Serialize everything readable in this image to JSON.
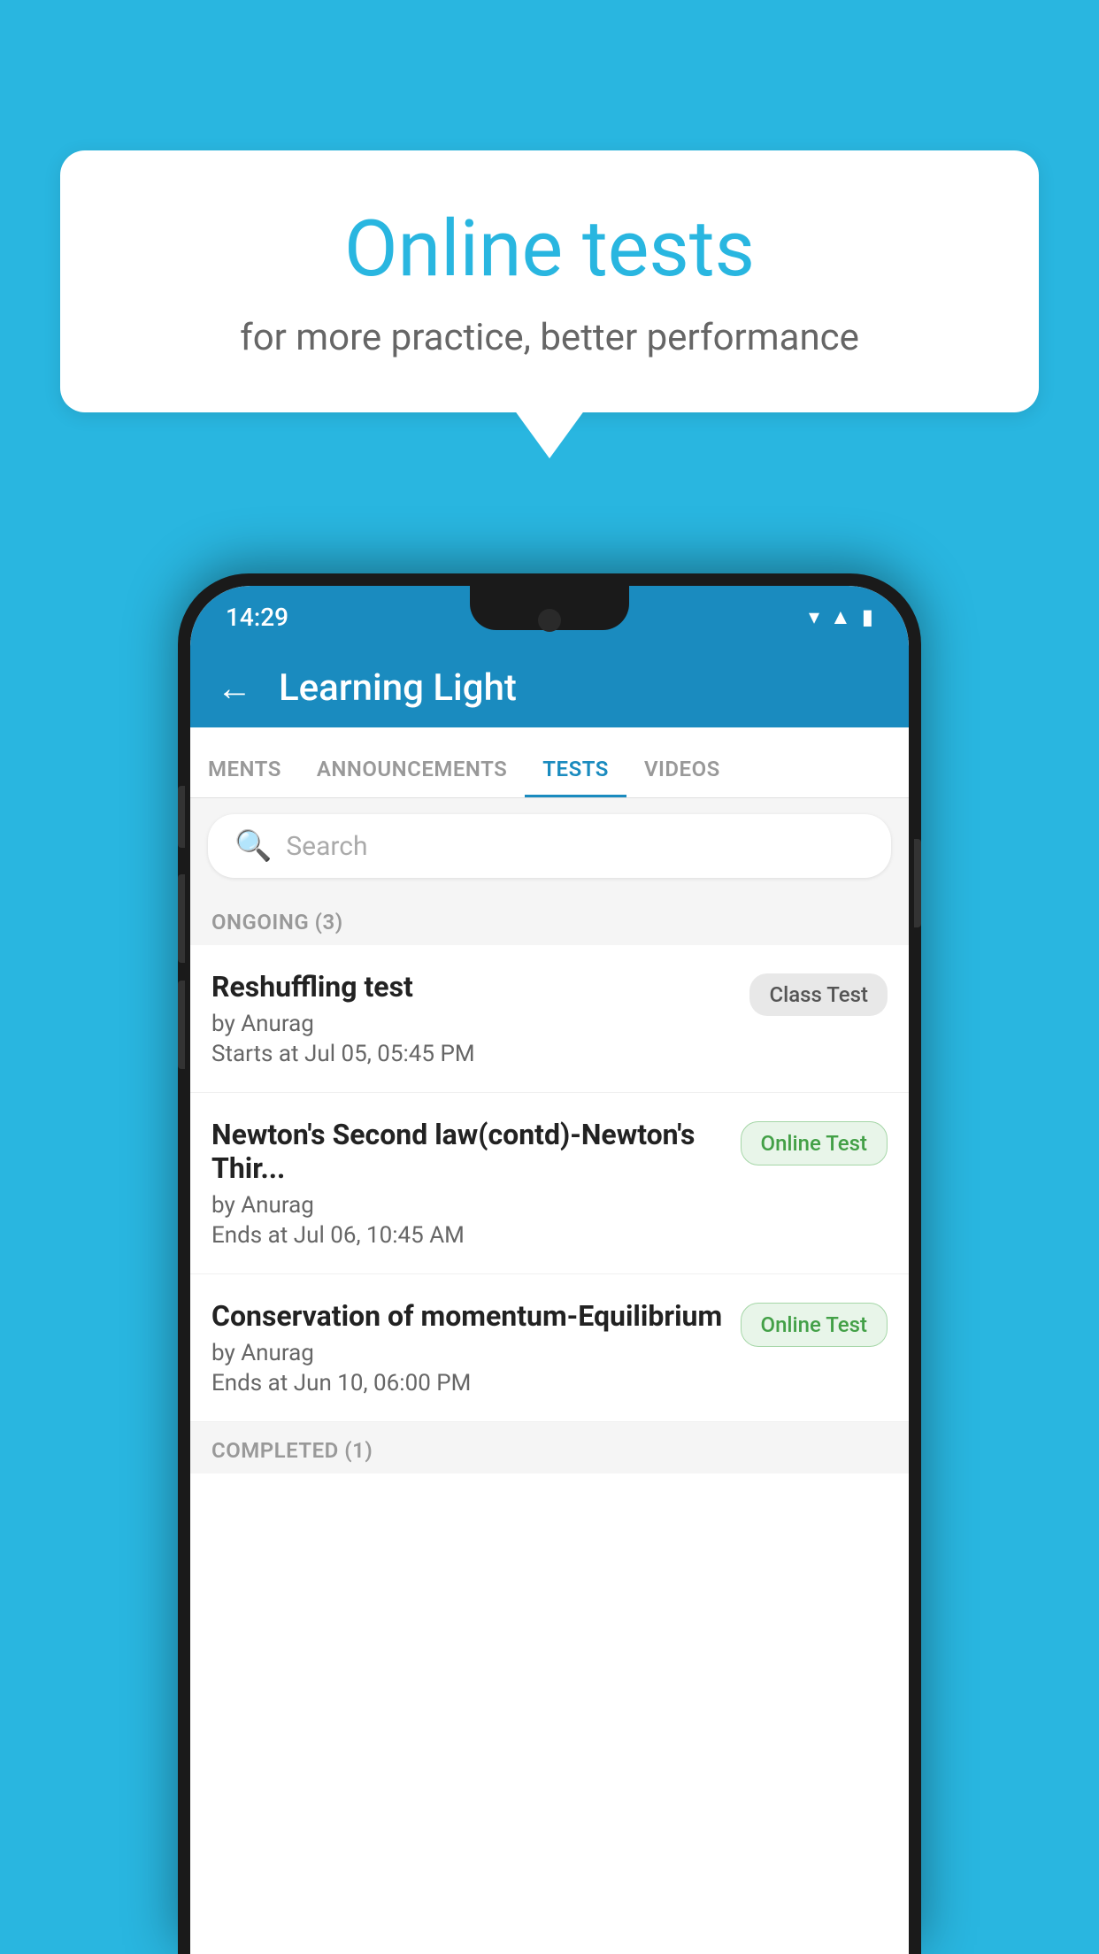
{
  "background": {
    "color": "#29b6e0"
  },
  "speech_bubble": {
    "title": "Online tests",
    "subtitle": "for more practice, better performance"
  },
  "phone": {
    "status_bar": {
      "time": "14:29",
      "icons": [
        "wifi",
        "signal",
        "battery"
      ]
    },
    "app_header": {
      "back_label": "←",
      "title": "Learning Light"
    },
    "tabs": [
      {
        "label": "MENTS",
        "active": false
      },
      {
        "label": "ANNOUNCEMENTS",
        "active": false
      },
      {
        "label": "TESTS",
        "active": true
      },
      {
        "label": "VIDEOS",
        "active": false
      }
    ],
    "search": {
      "placeholder": "Search",
      "icon": "🔍"
    },
    "sections": [
      {
        "label": "ONGOING (3)",
        "tests": [
          {
            "name": "Reshuffling test",
            "author": "by Anurag",
            "time_label": "Starts at",
            "time": "Jul 05, 05:45 PM",
            "badge": "Class Test",
            "badge_type": "class"
          },
          {
            "name": "Newton's Second law(contd)-Newton's Thir...",
            "author": "by Anurag",
            "time_label": "Ends at",
            "time": "Jul 06, 10:45 AM",
            "badge": "Online Test",
            "badge_type": "online"
          },
          {
            "name": "Conservation of momentum-Equilibrium",
            "author": "by Anurag",
            "time_label": "Ends at",
            "time": "Jun 10, 06:00 PM",
            "badge": "Online Test",
            "badge_type": "online"
          }
        ]
      },
      {
        "label": "COMPLETED (1)",
        "tests": []
      }
    ]
  }
}
